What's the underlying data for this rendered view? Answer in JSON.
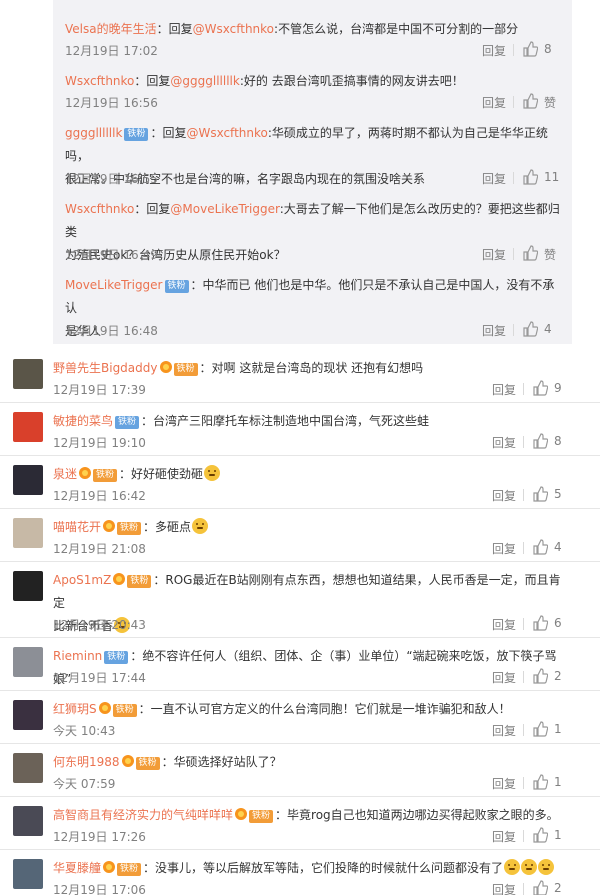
{
  "ui": {
    "reply_label": "回复",
    "fan_badge": "铁粉",
    "like_default": "赞"
  },
  "nested_replies": [
    {
      "user": "Velsa的晚年生活",
      "sep": "：回复",
      "mention": "@Wsxcfthnko",
      "text_lines": [
        ":不管怎么说，台湾都是中国不可分割的一部分"
      ],
      "time": "12月19日 17:02",
      "likes": "8",
      "badge": false
    },
    {
      "user": "Wsxcfthnko",
      "sep": "：回复",
      "mention": "@ggggllllllk",
      "text_lines": [
        ":好的 去跟台湾叽歪搞事情的网友讲去吧！"
      ],
      "time": "12月19日 16:56",
      "likes": "赞",
      "badge": false
    },
    {
      "user": "ggggllllllk",
      "sep": "：回复",
      "mention": "@Wsxcfthnko",
      "text_lines": [
        ":华硕成立的早了，两蒋时期不都认为自己是华华正统吗，",
        "很正常。中华航空不也是台湾的嘛，名字跟岛内现在的氛围没啥关系"
      ],
      "time": "12月19日 16:55",
      "likes": "11",
      "badge": true
    },
    {
      "user": "Wsxcfthnko",
      "sep": "：回复",
      "mention": "@MoveLikeTrigger",
      "text_lines": [
        ":大哥去了解一下他们是怎么改历史的？要把这些都归类",
        "为殖民史ok？台湾历史从原住民开始ok？"
      ],
      "time": "12月19日 16:49",
      "likes": "赞",
      "badge": false
    },
    {
      "user": "MoveLikeTrigger",
      "sep": "：",
      "mention": "",
      "text_lines": [
        "中华而已 他们也是中华。他们只是不承认自己是中国人，没有不承认",
        "是华人"
      ],
      "time": "12月19日 16:48",
      "likes": "4",
      "badge": true
    }
  ],
  "comments": [
    {
      "user": "野兽先生Bigdaddy",
      "vip": true,
      "text_lines": [
        "：对啊 这就是台湾岛的现状 还抱有幻想吗"
      ],
      "time": "12月19日 17:39",
      "likes": "9",
      "avatar_color": "#5a5548"
    },
    {
      "user": "敏捷的菜鸟",
      "vip": false,
      "badge": true,
      "text_lines": [
        "：台湾产三阳摩托车标注制造地中国台湾，气死这些蛙"
      ],
      "time": "12月19日 19:10",
      "likes": "8",
      "avatar_color": "#d9402b"
    },
    {
      "user": "泉迷",
      "vip": true,
      "text_lines": [
        "：好好砸使劲砸"
      ],
      "time": "12月19日 16:42",
      "likes": "5",
      "avatar_color": "#2b2a35",
      "emoji": true
    },
    {
      "user": "喵喵花开",
      "vip": true,
      "text_lines": [
        "：多砸点"
      ],
      "time": "12月19日 21:08",
      "likes": "4",
      "avatar_color": "#c7b9a6",
      "emoji": true
    },
    {
      "user": "ApoS1mZ",
      "vip": true,
      "text_lines": [
        "：ROG最近在B站刚刚有点东西，想想也知道结果，人民币香是一定，而且肯定",
        "比新台币香"
      ],
      "time": "12月19日 20:43",
      "likes": "6",
      "avatar_color": "#222222",
      "emoji": true
    },
    {
      "user": "Rieminn",
      "vip": false,
      "badge": true,
      "text_lines": [
        "：绝不容许任何人（组织、团体、企（事）业单位）“端起碗来吃饭，放下筷子骂娘”"
      ],
      "time": "12月19日 17:44",
      "likes": "2",
      "avatar_color": "#8c8f96"
    },
    {
      "user": "红狮玥S",
      "vip": true,
      "text_lines": [
        "：一直不认可官方定义的什么台湾同胞！它们就是一堆诈骗犯和敌人！"
      ],
      "time": "今天 10:43",
      "likes": "1",
      "avatar_color": "#3a3040"
    },
    {
      "user": "何东明1988",
      "vip": true,
      "text_lines": [
        "：华硕选择好站队了？"
      ],
      "time": "今天 07:59",
      "likes": "1",
      "avatar_color": "#6b6258"
    },
    {
      "user": "高智商且有经济实力的气纯咩咩咩",
      "vip": true,
      "text_lines": [
        "：毕竟rog自己也知道两边哪边买得起败家之眼的多。"
      ],
      "time": "12月19日 17:26",
      "likes": "1",
      "avatar_color": "#4a4a55"
    },
    {
      "user": "华夏滕艟",
      "vip": true,
      "text_lines": [
        "：没事儿，等以后解放军等陆，它们投降的时候就什么问题都没有了"
      ],
      "time": "12月19日 17:06",
      "likes": "2",
      "avatar_color": "#556677",
      "emoji3": true
    }
  ]
}
